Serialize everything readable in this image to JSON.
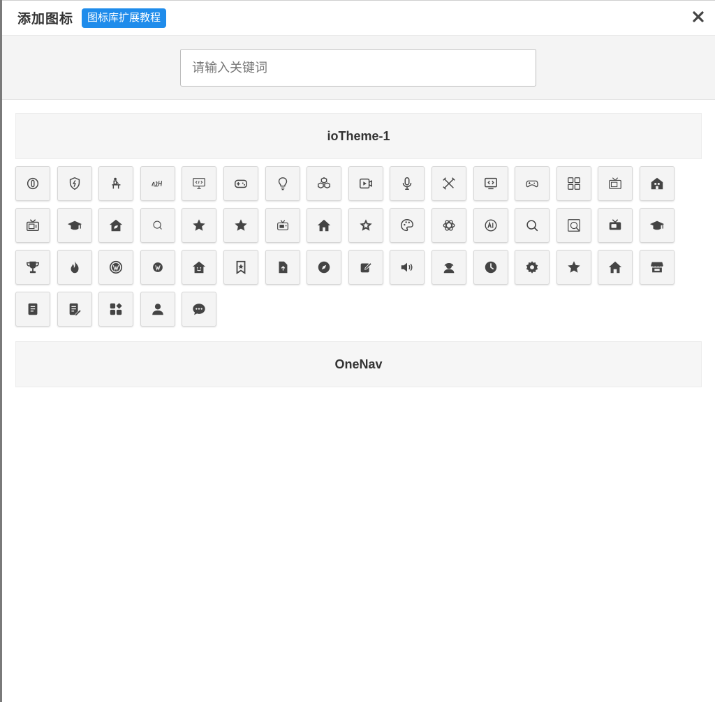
{
  "dialog": {
    "title": "添加图标",
    "tutorial_label": "图标库扩展教程"
  },
  "search": {
    "placeholder": "请输入关键词",
    "value": ""
  },
  "groups": [
    {
      "name": "ioTheme-1",
      "icons": [
        "info-circle-icon",
        "shield-bolt-icon",
        "desk-person-icon",
        "handwriting-icon",
        "monitor-code-icon",
        "gamepad-icon",
        "lightbulb-icon",
        "cubes-icon",
        "video-play-icon",
        "microphone-icon",
        "tools-icon",
        "screen-code-icon",
        "game-controller-icon",
        "grid-icon",
        "tv-icon",
        "home-building-icon",
        "retro-tv-icon",
        "graduation-cap-icon",
        "house-leaf-icon",
        "search-small-icon",
        "star-icon",
        "star-icon",
        "tv-small-icon",
        "house-icon",
        "star-outline-icon",
        "palette-icon",
        "openai-icon",
        "ai-circle-icon",
        "search-icon",
        "image-search-icon",
        "tv-filled-icon",
        "graduation-cap-icon",
        "trophy-icon",
        "fire-icon",
        "wordpress-icon",
        "wordpress-small-icon",
        "house-smile-icon",
        "bookmark-star-icon",
        "file-upload-icon",
        "compass-icon",
        "edit-icon",
        "speaker-icon",
        "user-headset-icon",
        "clock-icon",
        "gear-icon",
        "star-icon",
        "home-icon",
        "store-icon",
        "document-icon",
        "document-edit-icon",
        "apps-icon",
        "user-icon",
        "chat-bubble-icon"
      ]
    },
    {
      "name": "OneNav",
      "icons": []
    }
  ]
}
